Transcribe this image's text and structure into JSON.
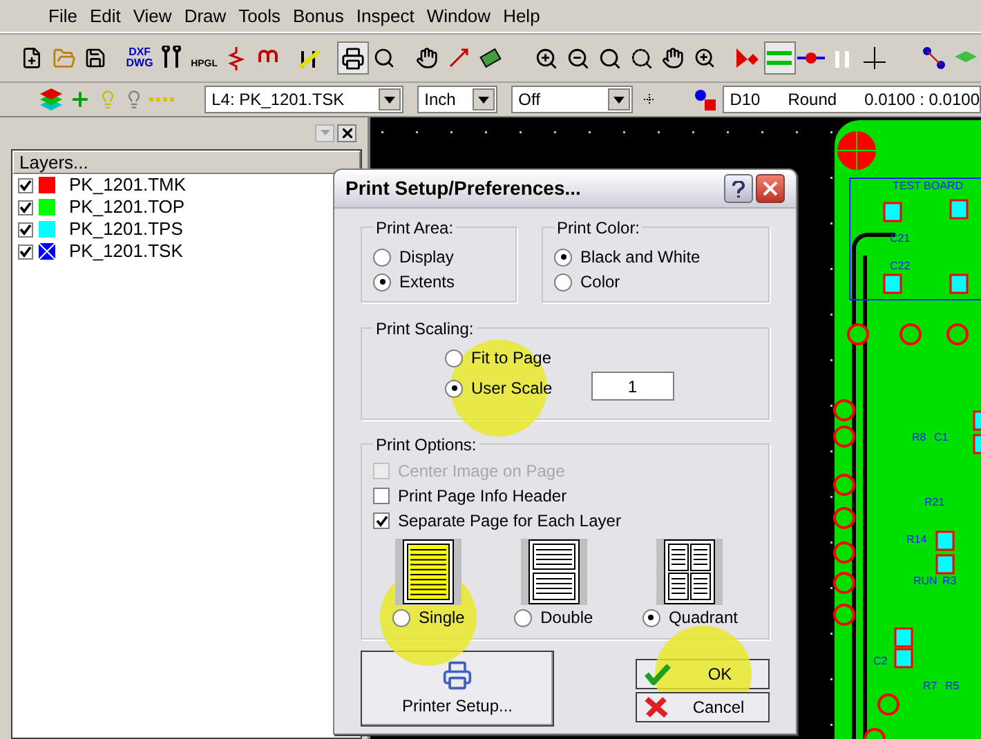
{
  "menu": [
    "File",
    "Edit",
    "View",
    "Draw",
    "Tools",
    "Bonus",
    "Inspect",
    "Window",
    "Help"
  ],
  "toolbar": {
    "dxf_label": "DXF DWG",
    "hpgl_label": "HPGL",
    "pressed": [
      {
        "selected": true
      },
      {
        "selected": true
      }
    ]
  },
  "layer_bar": {
    "layer_select": "L4: PK_1201.TSK",
    "unit_select": "Inch",
    "snap_select": "Off",
    "aperture": "D10",
    "shape": "Round",
    "size": "0.0100 : 0.0100"
  },
  "layers_panel": {
    "title": "Layers...",
    "items": [
      {
        "name": "PK_1201.TMK",
        "checked": true,
        "color": "#ff0000",
        "kind": "solid"
      },
      {
        "name": "PK_1201.TOP",
        "checked": true,
        "color": "#00ff00",
        "kind": "solid"
      },
      {
        "name": "PK_1201.TPS",
        "checked": true,
        "color": "#00ffff",
        "kind": "solid"
      },
      {
        "name": "PK_1201.TSK",
        "checked": true,
        "color": "#0000ff",
        "kind": "crossed"
      }
    ]
  },
  "pcb_labels": [
    "TEST BOARD",
    "C21",
    "C22",
    "R8",
    "C1",
    "R21",
    "R14",
    "RUN",
    "R3",
    "C2",
    "R7",
    "R5"
  ],
  "dialog": {
    "title": "Print Setup/Preferences...",
    "print_area": {
      "label": "Print Area:",
      "options": [
        {
          "label": "Display",
          "selected": false
        },
        {
          "label": "Extents",
          "selected": true
        }
      ]
    },
    "print_color": {
      "label": "Print Color:",
      "options": [
        {
          "label": "Black and White",
          "selected": true
        },
        {
          "label": "Color",
          "selected": false
        }
      ]
    },
    "print_scaling": {
      "label": "Print Scaling:",
      "options": [
        {
          "label": "Fit to Page",
          "selected": false,
          "highlighted": false
        },
        {
          "label": "User Scale",
          "selected": true,
          "highlighted": true
        }
      ],
      "scale_value": "1"
    },
    "print_options": {
      "label": "Print Options:",
      "checkboxes": [
        {
          "label": "Center Image on Page",
          "checked": false,
          "disabled": true
        },
        {
          "label": "Print Page Info Header",
          "checked": false,
          "disabled": false
        },
        {
          "label": "Separate Page for Each Layer",
          "checked": true,
          "disabled": false
        }
      ],
      "layouts": [
        {
          "label": "Single",
          "kind": "single",
          "selected": false,
          "highlighted": true
        },
        {
          "label": "Double",
          "kind": "double",
          "selected": false,
          "highlighted": false
        },
        {
          "label": "Quadrant",
          "kind": "quadrant",
          "selected": true,
          "highlighted": false
        }
      ]
    },
    "printer_setup": "Printer Setup...",
    "ok": {
      "label": "OK",
      "highlighted": true
    },
    "cancel": {
      "label": "Cancel",
      "highlighted": false
    }
  }
}
